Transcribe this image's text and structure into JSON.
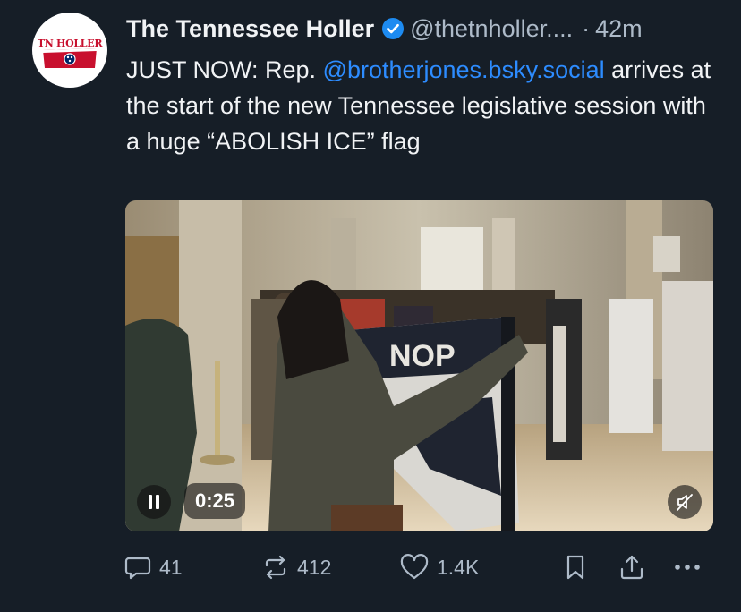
{
  "post": {
    "author": {
      "display_name": "The Tennessee Holler",
      "handle": "@thetnholler....",
      "avatar_text": "TN HOLLER",
      "verified_icon": "verified-check-icon"
    },
    "time_separator": "·",
    "time": "42m",
    "text_before": "JUST NOW: Rep. ",
    "mention": "@brotherjones.bsky.social",
    "text_after": " arrives at the start of the new Tennessee legislative session with a huge “ABOLISH ICE” flag"
  },
  "video": {
    "elapsed": "0:25",
    "pause_icon": "pause-icon",
    "mute_icon": "speaker-muted-icon",
    "banner_text": "NOP"
  },
  "actions": {
    "reply_count": "41",
    "repost_count": "412",
    "like_count": "1.4K"
  },
  "colors": {
    "background": "#161e27",
    "text": "#f1f3f5",
    "muted": "#aebbc9",
    "link": "#2d8cff",
    "verified": "#1d8bf1",
    "brand_red": "#c8102e"
  }
}
